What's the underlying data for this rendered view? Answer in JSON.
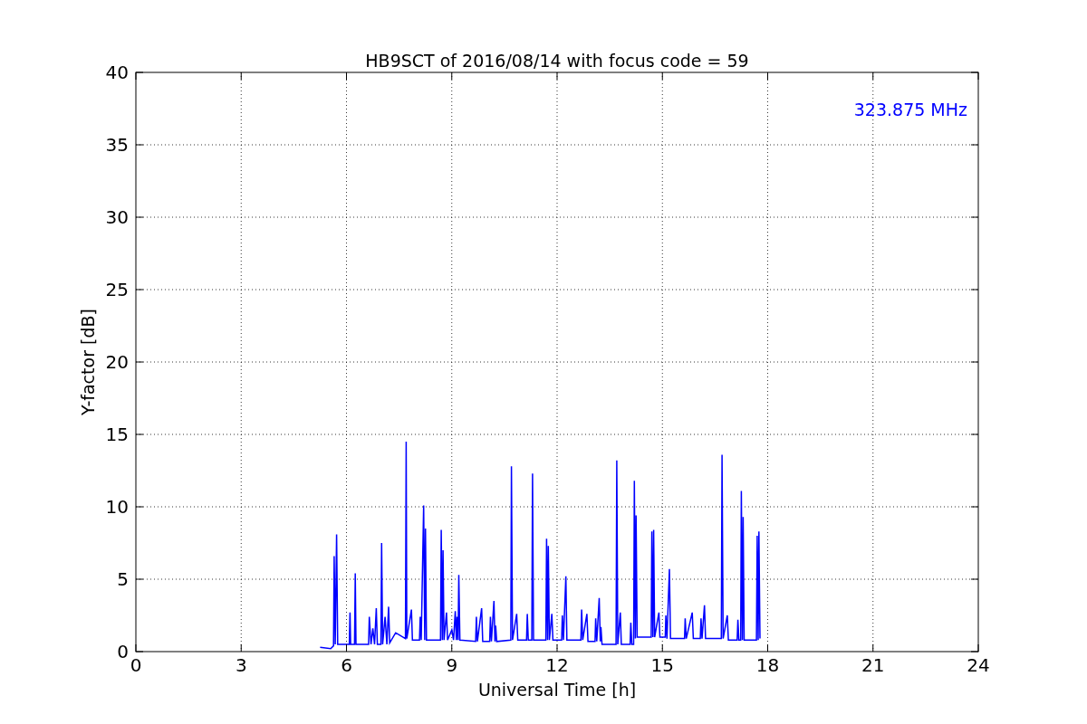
{
  "chart_data": {
    "type": "line",
    "title": "HB9SCT of 2016/08/14 with focus code = 59",
    "xlabel": "Universal Time [h]",
    "ylabel": "Y-factor [dB]",
    "xlim": [
      0,
      24
    ],
    "ylim": [
      0,
      40
    ],
    "grid": true,
    "xticks": [
      0,
      3,
      6,
      9,
      12,
      15,
      18,
      21,
      24
    ],
    "yticks": [
      0,
      5,
      10,
      15,
      20,
      25,
      30,
      35,
      40
    ],
    "x": [
      5.25,
      5.55,
      5.63,
      5.65,
      5.68,
      5.72,
      5.75,
      6.08,
      6.1,
      6.12,
      6.23,
      6.25,
      6.27,
      6.63,
      6.65,
      6.7,
      6.75,
      6.8,
      6.85,
      6.88,
      6.98,
      7.0,
      7.03,
      7.1,
      7.15,
      7.2,
      7.23,
      7.4,
      7.68,
      7.7,
      7.72,
      7.85,
      7.88,
      8.08,
      8.1,
      8.13,
      8.2,
      8.23,
      8.25,
      8.28,
      8.68,
      8.7,
      8.73,
      8.75,
      8.78,
      8.85,
      8.88,
      9.0,
      9.05,
      9.1,
      9.13,
      9.15,
      9.18,
      9.2,
      9.23,
      9.68,
      9.7,
      9.73,
      9.85,
      9.88,
      10.08,
      10.1,
      10.13,
      10.2,
      10.23,
      10.25,
      10.28,
      10.68,
      10.7,
      10.73,
      10.85,
      10.88,
      11.13,
      11.15,
      11.18,
      11.28,
      11.3,
      11.33,
      11.68,
      11.7,
      11.73,
      11.75,
      11.78,
      11.85,
      11.88,
      12.13,
      12.15,
      12.18,
      12.25,
      12.28,
      12.68,
      12.7,
      12.73,
      12.85,
      12.88,
      13.08,
      13.1,
      13.13,
      13.2,
      13.23,
      13.25,
      13.28,
      13.68,
      13.7,
      13.73,
      13.8,
      13.83,
      14.08,
      14.1,
      14.13,
      14.18,
      14.2,
      14.23,
      14.25,
      14.28,
      14.68,
      14.7,
      14.73,
      14.75,
      14.78,
      14.9,
      14.93,
      15.08,
      15.1,
      15.13,
      15.2,
      15.23,
      15.63,
      15.65,
      15.68,
      15.85,
      15.88,
      16.08,
      16.1,
      16.13,
      16.2,
      16.23,
      16.68,
      16.7,
      16.73,
      16.85,
      16.88,
      17.13,
      17.15,
      17.18,
      17.23,
      17.25,
      17.28,
      17.3,
      17.33,
      17.68,
      17.7,
      17.73,
      17.75,
      17.78
    ],
    "series": [
      {
        "name": "323.875 MHz",
        "color": "#0000ff",
        "values": [
          0.3,
          0.2,
          0.4,
          6.6,
          0.5,
          8.1,
          0.5,
          0.5,
          2.7,
          0.5,
          0.5,
          5.4,
          0.5,
          0.5,
          2.4,
          0.5,
          1.6,
          0.5,
          3.0,
          0.5,
          0.5,
          7.5,
          0.5,
          2.4,
          0.5,
          3.1,
          0.6,
          1.3,
          0.9,
          14.5,
          0.9,
          2.9,
          0.8,
          0.8,
          2.4,
          0.8,
          10.1,
          0.8,
          8.5,
          0.8,
          0.8,
          8.4,
          0.8,
          7.0,
          0.8,
          2.7,
          0.8,
          1.5,
          0.8,
          2.8,
          0.8,
          2.4,
          0.8,
          5.3,
          0.8,
          0.7,
          2.4,
          0.7,
          3.0,
          0.7,
          0.7,
          2.4,
          0.7,
          3.5,
          0.7,
          1.8,
          0.7,
          0.8,
          12.8,
          0.8,
          2.6,
          0.8,
          0.8,
          2.6,
          0.8,
          0.8,
          12.3,
          0.8,
          0.8,
          7.8,
          0.8,
          7.3,
          0.8,
          2.6,
          0.8,
          0.8,
          2.5,
          0.8,
          5.2,
          0.8,
          0.8,
          2.9,
          0.8,
          2.6,
          0.7,
          0.7,
          2.3,
          0.7,
          3.7,
          0.7,
          1.7,
          0.5,
          0.5,
          13.2,
          0.5,
          2.7,
          0.5,
          0.5,
          2.0,
          0.5,
          0.5,
          11.8,
          0.9,
          9.4,
          1.0,
          1.0,
          8.3,
          1.0,
          8.4,
          1.0,
          2.7,
          1.0,
          1.0,
          2.5,
          0.9,
          5.7,
          0.9,
          0.9,
          2.3,
          0.9,
          2.7,
          0.9,
          0.9,
          2.3,
          0.9,
          3.2,
          0.9,
          0.9,
          13.6,
          0.9,
          2.5,
          0.8,
          0.8,
          2.2,
          0.8,
          0.8,
          11.1,
          0.8,
          9.3,
          0.8,
          0.8,
          8.0,
          0.8,
          8.3,
          0.9
        ]
      }
    ]
  }
}
